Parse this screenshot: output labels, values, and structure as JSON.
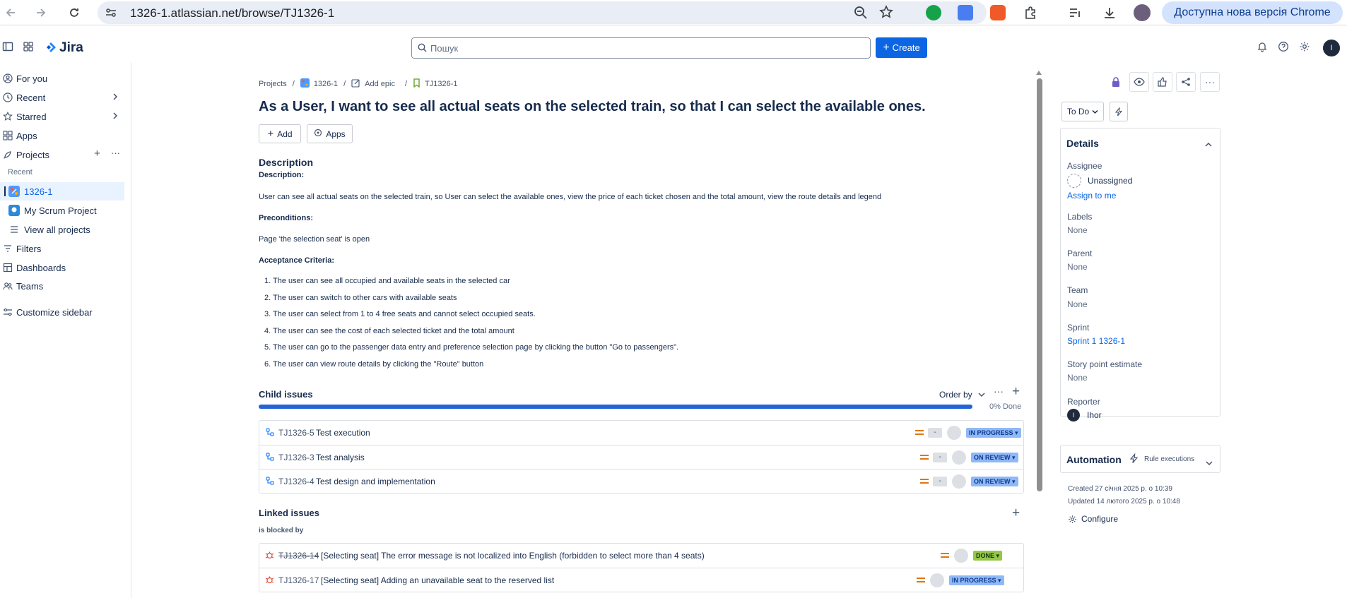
{
  "browser": {
    "url": "1326-1.atlassian.net/browse/TJ1326-1",
    "update_label": "Доступна нова версія Chrome"
  },
  "topnav": {
    "product_name": "Jira",
    "search_placeholder": "Пошук",
    "create_label": "Create",
    "avatar_initial": "I"
  },
  "sidebar": {
    "items": [
      {
        "label": "For you"
      },
      {
        "label": "Recent"
      },
      {
        "label": "Starred"
      },
      {
        "label": "Apps"
      },
      {
        "label": "Projects"
      }
    ],
    "recent_heading": "Recent",
    "projects": [
      {
        "label": "1326-1"
      },
      {
        "label": "My Scrum Project"
      },
      {
        "label": "View all projects"
      }
    ],
    "bottom_items": [
      {
        "label": "Filters"
      },
      {
        "label": "Dashboards"
      },
      {
        "label": "Teams"
      },
      {
        "label": "Customize sidebar"
      }
    ]
  },
  "breadcrumb": {
    "projects": "Projects",
    "project": "1326-1",
    "epic": "Add epic",
    "issue": "TJ1326-1"
  },
  "issue": {
    "title": "As a User, I want to see all actual seats on the selected train, so that I can select the available ones.",
    "add_label": "Add",
    "apps_label": "Apps",
    "description_heading": "Description",
    "description_label": "Description:",
    "description_text": "User can see all actual seats on the selected train, so User can select the available ones, view the price of each ticket chosen and the total amount, view the route details and legend",
    "preconditions_label": "Preconditions:",
    "preconditions_text": "Page 'the selection seat' is open",
    "acceptance_label": "Acceptance Criteria:",
    "acceptance_items": [
      "1. The user can see all occupied and available seats in the selected car",
      "2. The user can switch to other cars with available seats",
      "3. The user can select from 1 to 4 free seats and cannot select occupied seats.",
      "4. The user can see the cost of each selected ticket and the total amount",
      "5. The user can go to the passenger data entry and preference selection page by clicking the button \"Go to passengers\".",
      "6. The user can view route details by clicking the \"Route\" button"
    ]
  },
  "child_issues": {
    "title": "Child issues",
    "order_by": "Order by",
    "progress_label": "0% Done",
    "progress_done": 0,
    "rows": [
      {
        "key": "TJ1326-5",
        "summary": "Test execution",
        "estimate": "-",
        "status": "IN PROGRESS"
      },
      {
        "key": "TJ1326-3",
        "summary": "Test analysis",
        "estimate": "-",
        "status": "ON REVIEW"
      },
      {
        "key": "TJ1326-4",
        "summary": "Test design and implementation",
        "estimate": "-",
        "status": "ON REVIEW"
      }
    ]
  },
  "linked_issues": {
    "title": "Linked issues",
    "relation": "is blocked by",
    "rows": [
      {
        "key": "TJ1326-14",
        "summary": "[Selecting seat] The error message is not localized into English (forbidden to select more than 4 seats)",
        "status": "DONE"
      },
      {
        "key": "TJ1326-17",
        "summary": "[Selecting seat] Adding an unavailable seat to the reserved list",
        "status": "IN PROGRESS"
      }
    ]
  },
  "right_panel": {
    "status_button": "To Do",
    "details_title": "Details",
    "assignee_label": "Assignee",
    "assignee_value": "Unassigned",
    "assign_to_me": "Assign to me",
    "labels_label": "Labels",
    "labels_value": "None",
    "parent_label": "Parent",
    "parent_value": "None",
    "team_label": "Team",
    "team_value": "None",
    "sprint_label": "Sprint",
    "sprint_value": "Sprint 1 1326-1",
    "story_points_label": "Story point estimate",
    "story_points_value": "None",
    "reporter_label": "Reporter",
    "reporter_value": "Ihor",
    "reporter_initial": "I",
    "automation_title": "Automation",
    "rule_executions": "Rule executions",
    "created": "Created 27 січня 2025 р. о 10:39",
    "updated": "Updated 14 лютого 2025 р. о 10:48",
    "configure": "Configure"
  },
  "colors": {
    "accent": "#0c66e4",
    "progress": "#2563d6",
    "in_progress": "#8fb8f6",
    "done": "#94c748",
    "priority_medium": "#e2740c"
  }
}
